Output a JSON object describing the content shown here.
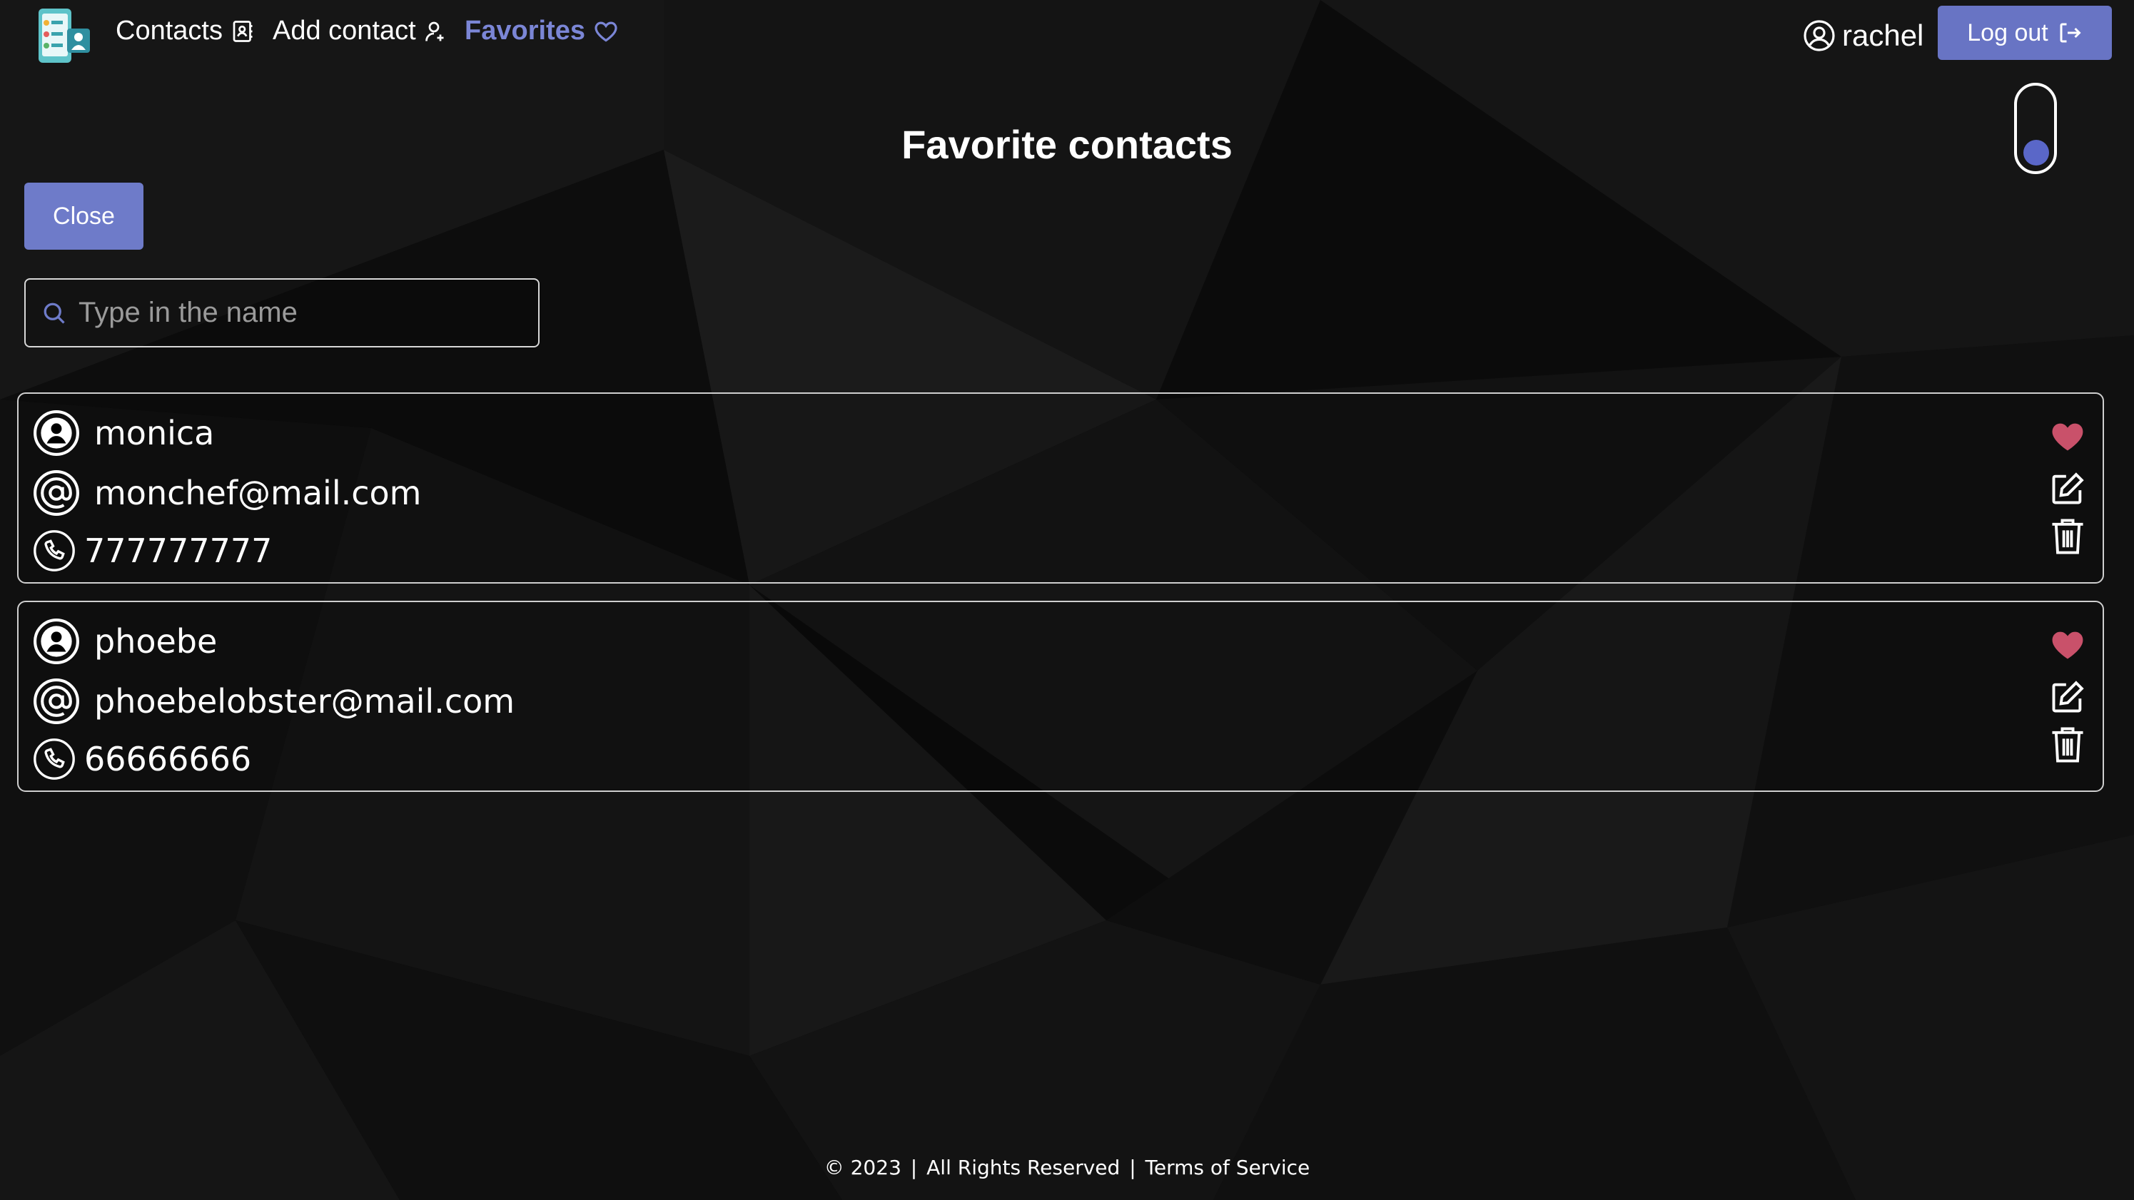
{
  "nav": {
    "contacts_label": "Contacts",
    "add_contact_label": "Add contact",
    "favorites_label": "Favorites",
    "user_name": "rachel",
    "logout_label": "Log out"
  },
  "page": {
    "title": "Favorite contacts",
    "close_label": "Close",
    "theme_toggle": "on"
  },
  "search": {
    "placeholder": "Type in the name",
    "value": ""
  },
  "contacts": [
    {
      "name": "monica",
      "email": "monchef@mail.com",
      "phone": "777777777",
      "favorite": true
    },
    {
      "name": "phoebe",
      "email": "phoebelobster@mail.com",
      "phone": "66666666",
      "favorite": true
    }
  ],
  "footer": {
    "copyright": "© 2023",
    "rights": "All Rights Reserved",
    "separator": "|",
    "terms": "Terms of Service"
  },
  "colors": {
    "accent": "#6e7bc9",
    "favorites_link": "#7b86d6",
    "heart": "#c9516a",
    "background": "#0a0a0a"
  },
  "icons": [
    "app-logo-icon",
    "address-book-icon",
    "person-add-icon",
    "heart-outline-icon",
    "user-circle-icon",
    "logout-icon",
    "search-icon",
    "user-avatar-icon",
    "at-sign-icon",
    "phone-icon",
    "heart-filled-icon",
    "edit-icon",
    "trash-icon"
  ]
}
